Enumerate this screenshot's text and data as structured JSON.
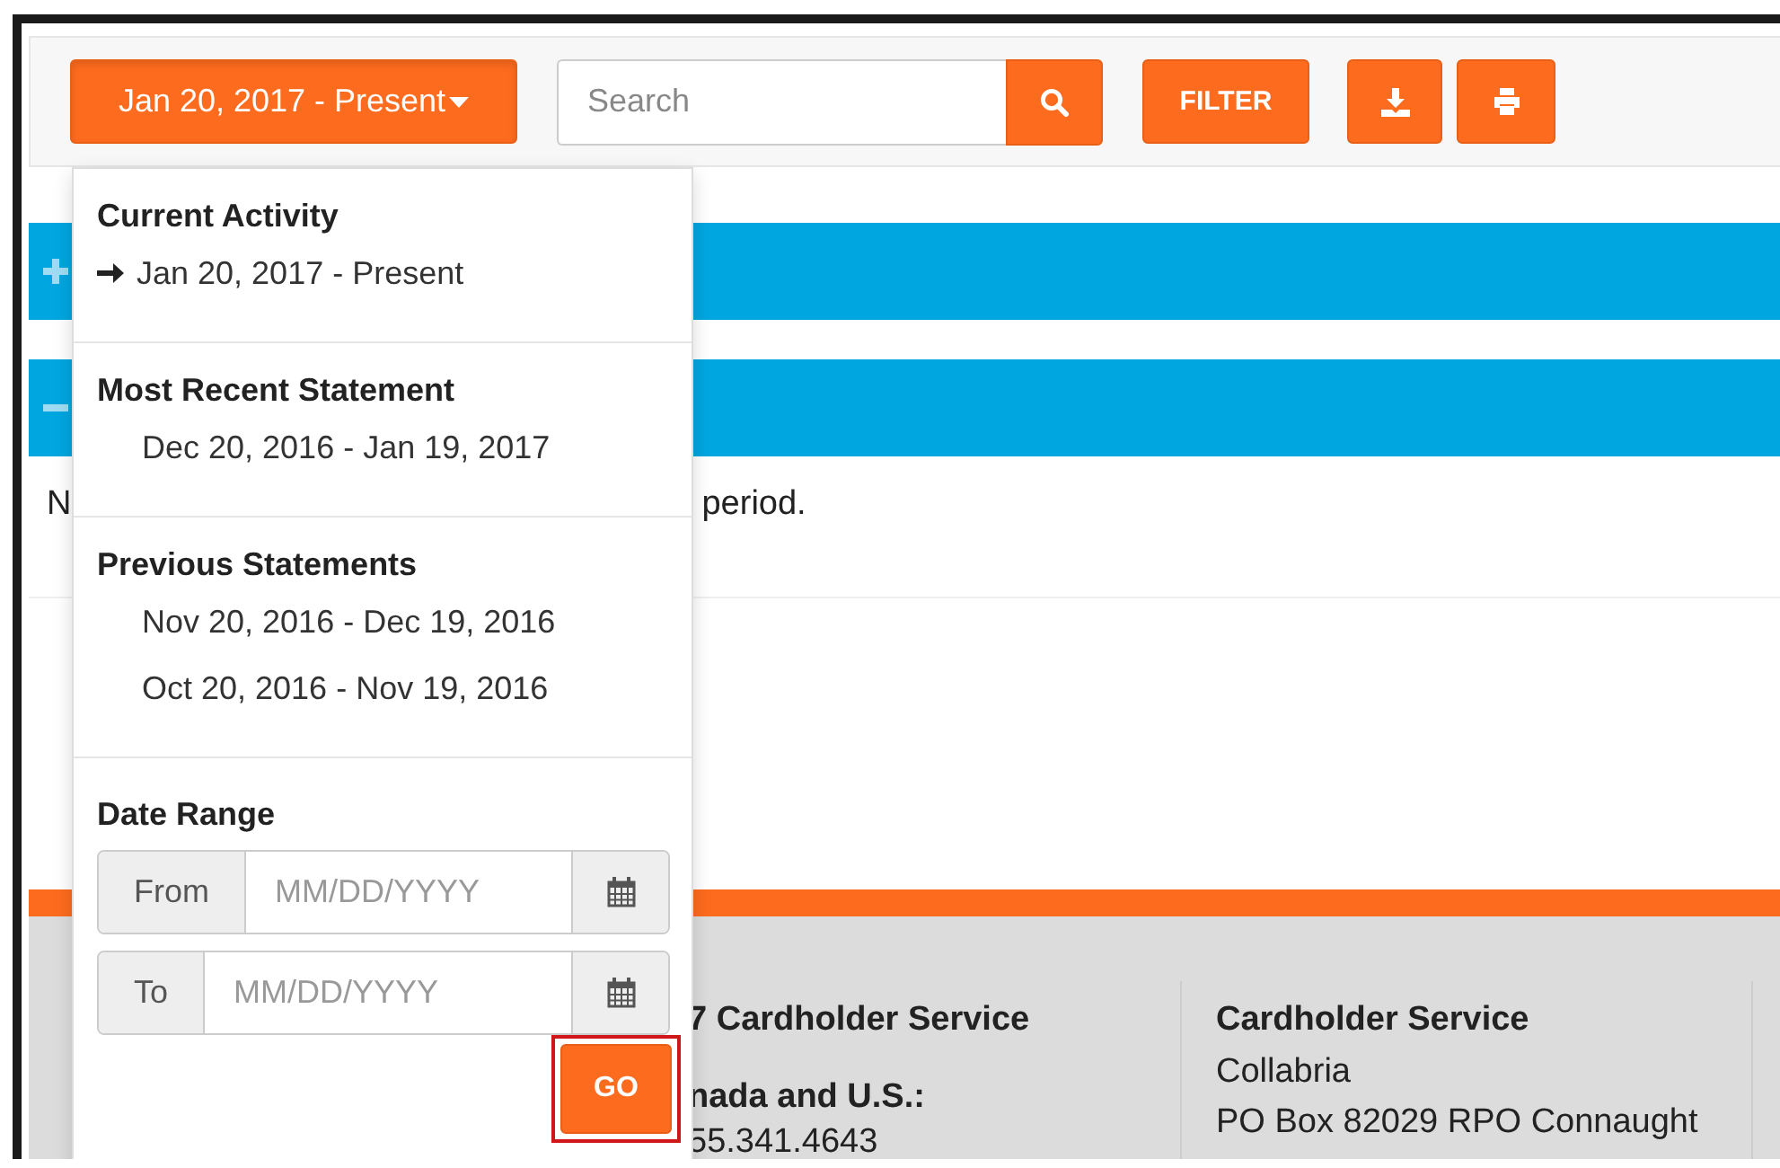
{
  "toolbar": {
    "date_button": {
      "label": "Jan 20, 2017 - Present",
      "expanded": true
    },
    "search": {
      "placeholder": "Search"
    },
    "filter_button": "FILTER"
  },
  "panels": [
    {
      "expanded": false
    },
    {
      "expanded": true
    }
  ],
  "message_fragments": [
    "N",
    "period."
  ],
  "dropdown": {
    "sections": [
      {
        "heading": "Current Activity",
        "items": [
          {
            "label": "Jan 20, 2017 - Present",
            "selected": true
          }
        ]
      },
      {
        "heading": "Most Recent Statement",
        "items": [
          {
            "label": "Dec 20, 2016 - Jan 19, 2017",
            "selected": false
          }
        ]
      },
      {
        "heading": "Previous Statements",
        "items": [
          {
            "label": "Nov 20, 2016 - Dec 19, 2016",
            "selected": false
          },
          {
            "label": "Oct 20, 2016 - Nov 19, 2016",
            "selected": false
          }
        ]
      }
    ],
    "date_range": {
      "heading": "Date Range",
      "fields": [
        {
          "label": "From",
          "placeholder": "MM/DD/YYYY"
        },
        {
          "label": "To",
          "placeholder": "MM/DD/YYYY"
        }
      ],
      "go_button": "GO",
      "go_highlighted": true
    }
  },
  "footer": {
    "columns": [
      {
        "lines": [
          {
            "text": "7 Cardholder Service",
            "kind": "heading"
          },
          {
            "text": "nada and U.S.:",
            "kind": "heading"
          },
          {
            "text": "55.341.4643",
            "kind": "text"
          }
        ]
      },
      {
        "lines": [
          {
            "text": "Cardholder Service",
            "kind": "heading"
          },
          {
            "text": "Collabria",
            "kind": "text"
          },
          {
            "text": "PO Box 82029 RPO Connaught",
            "kind": "text"
          }
        ]
      }
    ]
  }
}
